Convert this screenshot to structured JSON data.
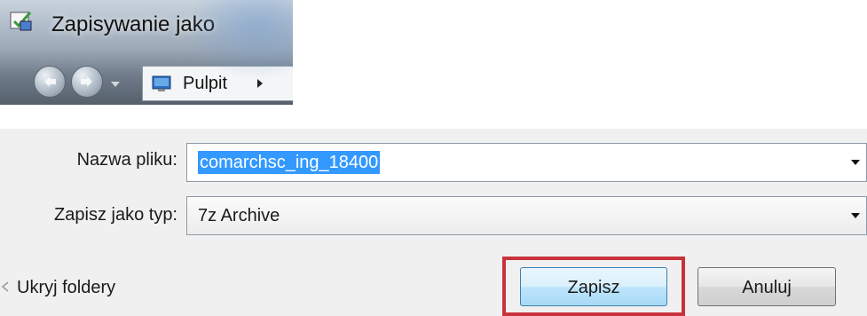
{
  "window": {
    "title": "Zapisywanie jako",
    "breadcrumb": [
      "Pulpit"
    ]
  },
  "form": {
    "filename_label": "Nazwa pliku:",
    "filename_value": "comarchsc_ing_18400",
    "filetype_label": "Zapisz jako typ:",
    "filetype_value": "7z Archive",
    "hide_folders": "Ukryj foldery"
  },
  "buttons": {
    "save": "Zapisz",
    "cancel": "Anuluj"
  },
  "colors": {
    "selection": "#3399ff",
    "highlight_box": "#c8323a"
  }
}
